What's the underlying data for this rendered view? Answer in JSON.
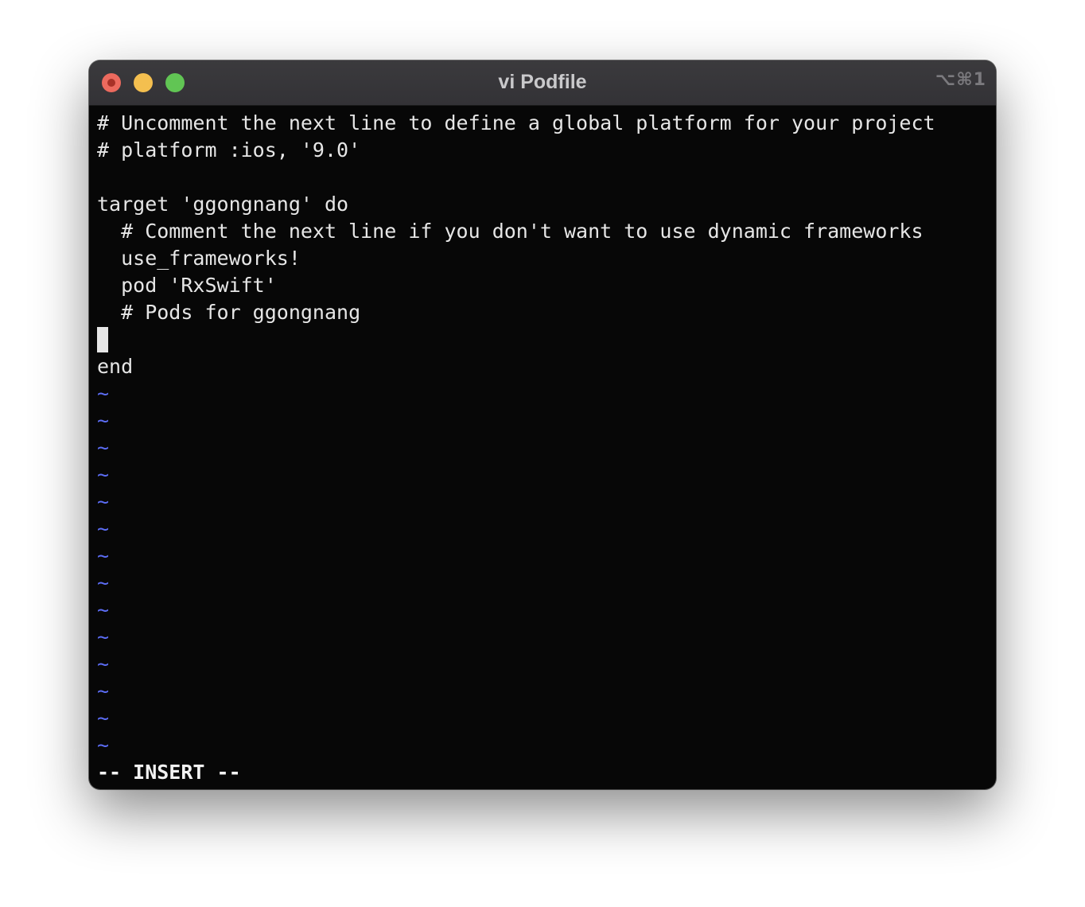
{
  "window": {
    "title": "vi Podfile",
    "shortcut": "⌥⌘1"
  },
  "editor": {
    "lines": [
      "# Uncomment the next line to define a global platform for your project",
      "# platform :ios, '9.0'",
      "",
      "target 'ggongnang' do",
      "  # Comment the next line if you don't want to use dynamic frameworks",
      "  use_frameworks!",
      "  pod 'RxSwift'",
      "  # Pods for ggongnang",
      "",
      "end"
    ],
    "empty_line_marker": "~",
    "status": "-- INSERT --"
  },
  "colors": {
    "background": "#070707",
    "text": "#e6e6e6",
    "tilde": "#5c6df5",
    "titlebar": "#363539"
  }
}
